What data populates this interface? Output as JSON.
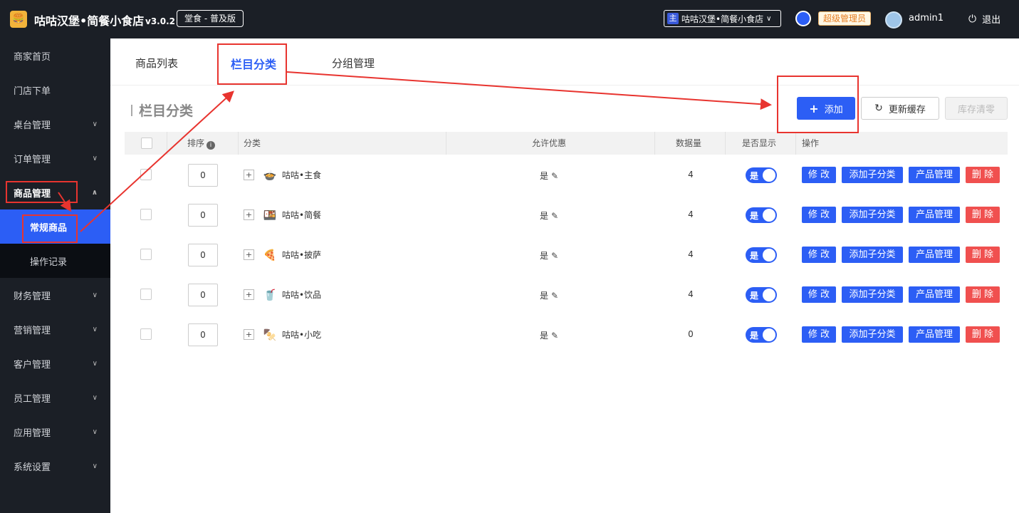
{
  "header": {
    "logo_icon": "burger-icon",
    "app_title": "咕咕汉堡•简餐小食店",
    "version": "v3.0.2",
    "edition": "堂食 - 普及版",
    "store_badge": "主",
    "store_name": "咕咕汉堡•简餐小食店",
    "role_badge": "超级管理员",
    "username": "admin1",
    "logout_label": "退出"
  },
  "sidebar": {
    "items": [
      {
        "label": "商家首页"
      },
      {
        "label": "门店下单"
      },
      {
        "label": "桌台管理"
      },
      {
        "label": "订单管理"
      },
      {
        "label": "商品管理"
      },
      {
        "label": "常规商品"
      },
      {
        "label": "操作记录"
      },
      {
        "label": "财务管理"
      },
      {
        "label": "营销管理"
      },
      {
        "label": "客户管理"
      },
      {
        "label": "员工管理"
      },
      {
        "label": "应用管理"
      },
      {
        "label": "系统设置"
      }
    ]
  },
  "tabs": [
    {
      "label": "商品列表"
    },
    {
      "label": "栏目分类"
    },
    {
      "label": "分组管理"
    }
  ],
  "section_title": "栏目分类",
  "toolbar": {
    "add_label": "添加",
    "refresh_label": "更新缓存",
    "clear_label": "库存清零"
  },
  "table": {
    "headers": {
      "sort": "排序",
      "category": "分类",
      "discount": "允许优惠",
      "count": "数据量",
      "visible": "是否显示",
      "actions": "操作"
    },
    "rows": [
      {
        "sort": "0",
        "icon": "bowl-icon",
        "name": "咕咕•主食",
        "discount": "是",
        "count": "4",
        "visible": "是"
      },
      {
        "sort": "0",
        "icon": "meal-icon",
        "name": "咕咕•简餐",
        "discount": "是",
        "count": "4",
        "visible": "是"
      },
      {
        "sort": "0",
        "icon": "pizza-icon",
        "name": "咕咕•披萨",
        "discount": "是",
        "count": "4",
        "visible": "是"
      },
      {
        "sort": "0",
        "icon": "drink-icon",
        "name": "咕咕•饮品",
        "discount": "是",
        "count": "4",
        "visible": "是"
      },
      {
        "sort": "0",
        "icon": "skewer-icon",
        "name": "咕咕•小吃",
        "discount": "是",
        "count": "0",
        "visible": "是"
      }
    ],
    "action_labels": {
      "edit": "修 改",
      "add_sub": "添加子分类",
      "products": "产品管理",
      "delete": "删 除"
    }
  },
  "colors": {
    "primary": "#2c5ef5",
    "danger": "#f0504f",
    "sidebar_bg": "#1b1f26",
    "annotation": "#e8342f"
  }
}
